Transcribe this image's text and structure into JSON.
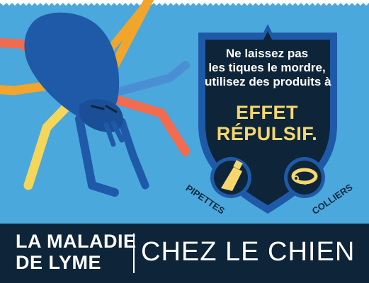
{
  "shield": {
    "message_lines": [
      "Ne laissez pas",
      "les tiques le mordre,",
      "utilisez des produits à"
    ],
    "highlight_lines": [
      "EFFET",
      "RÉPULSIF."
    ]
  },
  "products": {
    "pipettes": {
      "label": "PIPETTES",
      "icon": "pipette-icon"
    },
    "colliers": {
      "label": "COLLIERS",
      "icon": "collar-icon"
    }
  },
  "footer": {
    "title_lines": [
      "LA MALADIE",
      "DE LYME"
    ],
    "subtitle": "CHEZ LE CHIEN"
  },
  "colors": {
    "background": "#4aa8dc",
    "navy": "#0e2438",
    "tick": "#1e5aa8",
    "highlight": "#f5d76e",
    "orange": "#f2a52b",
    "coral": "#f26b4f",
    "yellow": "#f4d65a"
  }
}
